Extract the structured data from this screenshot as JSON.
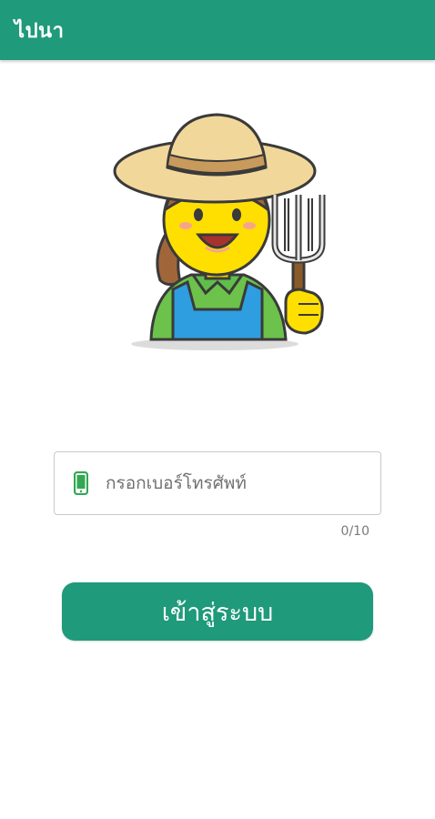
{
  "appbar": {
    "title": "ไปนา"
  },
  "illustration": {
    "icon": "farmer-woman-icon"
  },
  "phone": {
    "icon": "phone-icon",
    "placeholder": "กรอกเบอร์โทรศัพท์",
    "counter": "0/10"
  },
  "actions": {
    "login_label": "เข้าสู่ระบบ"
  },
  "colors": {
    "primary": "#1f9a7a",
    "phone_icon": "#33a853"
  }
}
